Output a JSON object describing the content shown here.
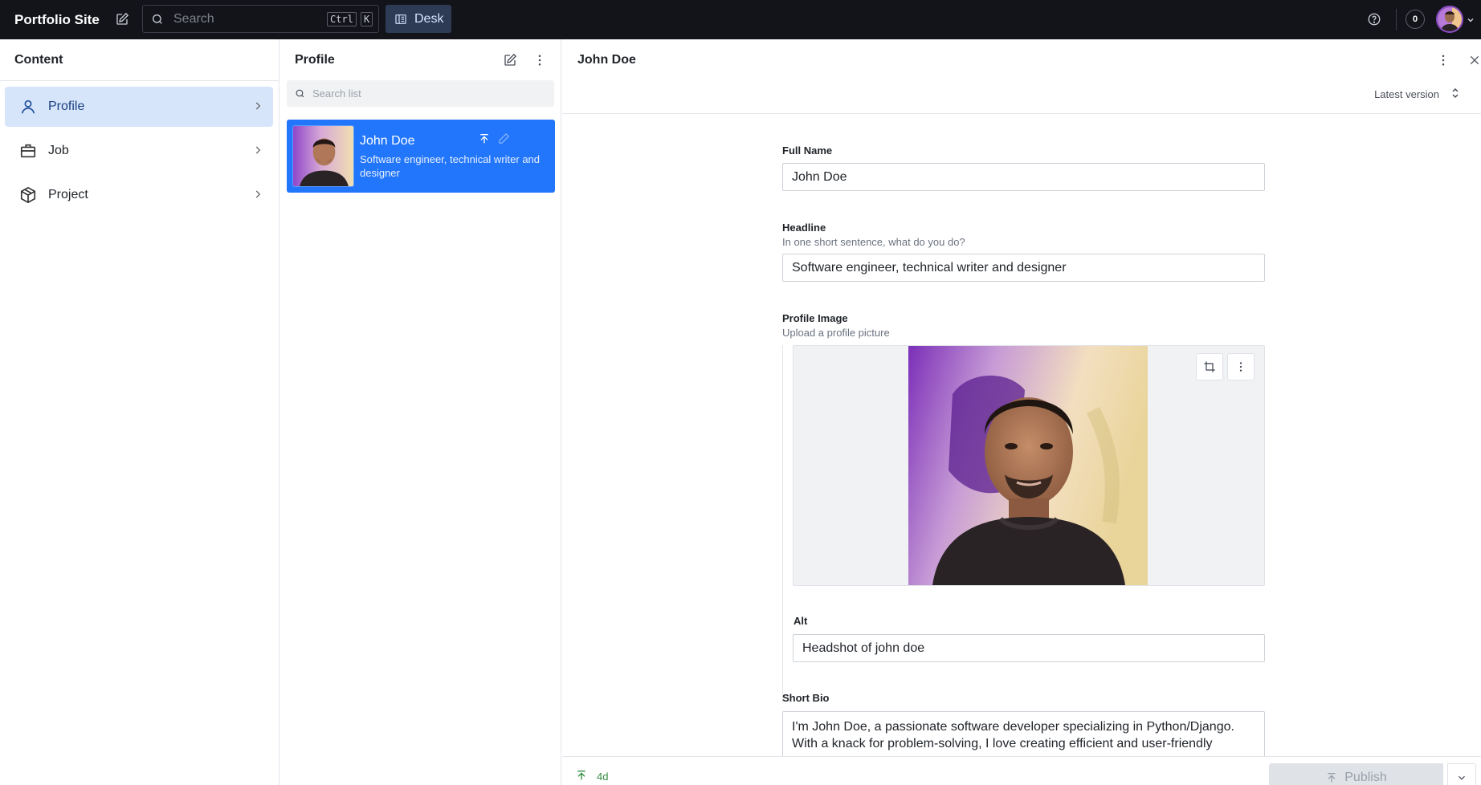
{
  "topbar": {
    "brand": "Portfolio Site",
    "search_placeholder": "Search",
    "shortcut_ctrl": "Ctrl",
    "shortcut_key": "K",
    "desk_label": "Desk",
    "notification_count": "0"
  },
  "content_pane": {
    "title": "Content",
    "items": [
      {
        "label": "Profile",
        "icon": "user-icon",
        "active": true
      },
      {
        "label": "Job",
        "icon": "briefcase-icon",
        "active": false
      },
      {
        "label": "Project",
        "icon": "package-icon",
        "active": false
      }
    ]
  },
  "profile_pane": {
    "title": "Profile",
    "search_placeholder": "Search list",
    "items": [
      {
        "title": "John Doe",
        "subtitle": "Software engineer, technical writer and designer",
        "selected": true
      }
    ]
  },
  "document": {
    "title": "John Doe",
    "version_label": "Latest version",
    "fields": {
      "full_name": {
        "label": "Full Name",
        "value": "John Doe"
      },
      "headline": {
        "label": "Headline",
        "description": "In one short sentence, what do you do?",
        "value": "Software engineer, technical writer and designer"
      },
      "profile_image": {
        "label": "Profile Image",
        "description": "Upload a profile picture"
      },
      "alt": {
        "label": "Alt",
        "value": "Headshot of john doe"
      },
      "short_bio": {
        "label": "Short Bio",
        "value": "I'm John Doe, a passionate software developer specializing in Python/Django. With a knack for problem-solving, I love creating efficient and user-friendly"
      }
    },
    "footer": {
      "status": "4d",
      "publish_label": "Publish"
    }
  },
  "colors": {
    "topbar_bg": "#13141a",
    "accent": "#2276fc",
    "active_nav_bg": "#d7e5fb",
    "status_green": "#2f8a3f"
  }
}
